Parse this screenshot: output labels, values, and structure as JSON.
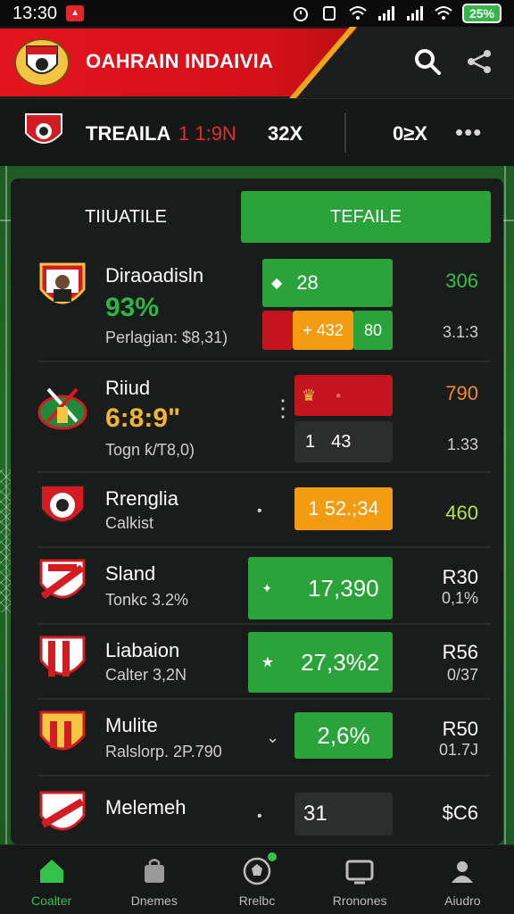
{
  "status": {
    "time": "13:30",
    "battery": "25%"
  },
  "header": {
    "title": "OAHRAIN INDAIVIA"
  },
  "match": {
    "team": "TREAILA",
    "score": "1 1:9N",
    "odd1": "32X",
    "odd2": "0≥X",
    "more": "•••"
  },
  "tabs": [
    {
      "label": "TIIUATILE"
    },
    {
      "label": "TEFAILE"
    }
  ],
  "rows": [
    {
      "name": "Diraoadisln",
      "pct": "93%",
      "sub": "Perlagian: $8,31)",
      "odds": [
        "28",
        "+ 432",
        "80"
      ],
      "right": "306",
      "right_sub": "3.1:3",
      "right_color": "#35c04a"
    },
    {
      "name": "Riiud",
      "pct": "6:8:9\"",
      "sub": "Togn ƙ/Ƭ8,0)",
      "odds": [
        "",
        "1",
        "43"
      ],
      "right": "790",
      "right_sub": "1.33",
      "right_color": "#f08a24"
    },
    {
      "name": "Rrenglia",
      "pct": "",
      "sub": "Calkist",
      "odds": [
        "1 52.;34"
      ],
      "right": "460",
      "right_sub": "",
      "right_color": "#b6e33b"
    },
    {
      "name": "Sland",
      "pct": "",
      "sub": "Tonkc 3.2%",
      "odds": [
        "17,390"
      ],
      "right": "R30",
      "right_sub": "0,1%",
      "right_color": "#ffffff"
    },
    {
      "name": "Liabaion",
      "pct": "",
      "sub": "Calter 3,2N",
      "odds": [
        "27,3%2"
      ],
      "right": "R56",
      "right_sub": "0/37",
      "right_color": "#ffffff"
    },
    {
      "name": "Mulite",
      "pct": "",
      "sub": "Ralslorp. 2P.790",
      "odds": [
        "2,6%"
      ],
      "right": "R50",
      "right_sub": "01.7J",
      "right_color": "#ffffff"
    },
    {
      "name": "Melemeh",
      "pct": "",
      "sub": "",
      "odds": [
        "31"
      ],
      "right": "$C6",
      "right_sub": "",
      "right_color": "#ffffff"
    }
  ],
  "nav": [
    {
      "label": "Coalter",
      "icon": "home-icon"
    },
    {
      "label": "Dnemes",
      "icon": "bag-icon"
    },
    {
      "label": "Rrelbc",
      "icon": "ball-icon"
    },
    {
      "label": "Rronones",
      "icon": "tv-icon"
    },
    {
      "label": "Aiudro",
      "icon": "profile-icon"
    }
  ],
  "colors": {
    "accent_green": "#2aa33a",
    "brand_red": "#e3141d",
    "orange": "#f39c12"
  }
}
